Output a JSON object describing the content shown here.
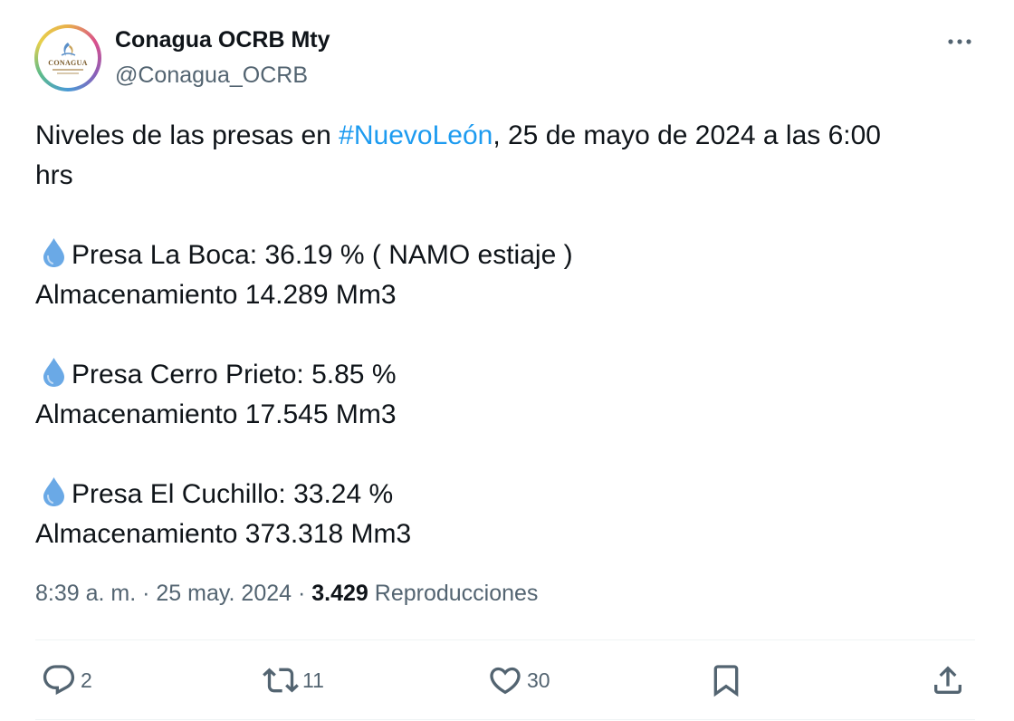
{
  "author": {
    "display_name": "Conagua OCRB Mty",
    "handle": "@Conagua_OCRB",
    "avatar_logo_text": "CONAGUA",
    "avatar_icon": "conagua-logo"
  },
  "more_icon": "more-horizontal-icon",
  "post": {
    "intro_before": "Niveles de las presas en ",
    "hashtag": "#NuevoLeón",
    "intro_after": ", 25 de mayo de 2024 a las 6:00",
    "intro_line2": "hrs",
    "drop_icon": "droplet-icon",
    "dams": [
      {
        "level": "Presa La Boca: 36.19 % ( NAMO estiaje )",
        "storage": "Almacenamiento 14.289 Mm3"
      },
      {
        "level": "Presa Cerro Prieto: 5.85 %",
        "storage": "Almacenamiento 17.545 Mm3"
      },
      {
        "level": "Presa El Cuchillo: 33.24 %",
        "storage": "Almacenamiento 373.318 Mm3"
      }
    ]
  },
  "meta": {
    "time": "8:39 a. m.",
    "separator": " · ",
    "date": "25 may. 2024",
    "views_count": "3.429",
    "views_label": " Reproducciones"
  },
  "actions": {
    "reply": {
      "icon": "reply-icon",
      "count": "2"
    },
    "repost": {
      "icon": "repost-icon",
      "count": "11"
    },
    "like": {
      "icon": "heart-icon",
      "count": "30"
    },
    "bookmark": {
      "icon": "bookmark-icon"
    },
    "share": {
      "icon": "share-icon"
    }
  },
  "colors": {
    "text": "#0f1419",
    "secondary": "#536471",
    "link": "#1d9bf0",
    "drop": "#6aa9e6",
    "divider": "#eff3f4"
  }
}
